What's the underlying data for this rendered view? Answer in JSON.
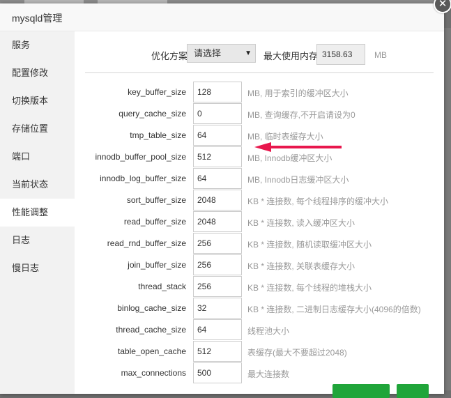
{
  "window": {
    "title": "mysqld管理",
    "close_glyph": "✕"
  },
  "sidebar": {
    "items": [
      {
        "label": "服务"
      },
      {
        "label": "配置修改"
      },
      {
        "label": "切换版本"
      },
      {
        "label": "存储位置"
      },
      {
        "label": "端口"
      },
      {
        "label": "当前状态"
      },
      {
        "label": "性能调整",
        "active": true
      },
      {
        "label": "日志"
      },
      {
        "label": "慢日志"
      }
    ]
  },
  "optimize": {
    "label": "优化方案",
    "selected": "请选择",
    "caret": "▼",
    "max_mem_label": "最大使用内存",
    "max_mem_value": "3158.63",
    "max_mem_unit": "MB"
  },
  "params": [
    {
      "name": "key_buffer_size",
      "value": "128",
      "desc": "MB, 用于索引的缓冲区大小"
    },
    {
      "name": "query_cache_size",
      "value": "0",
      "desc": "MB, 查询缓存,不开启请设为0"
    },
    {
      "name": "tmp_table_size",
      "value": "64",
      "desc": "MB, 临时表缓存大小"
    },
    {
      "name": "innodb_buffer_pool_size",
      "value": "512",
      "desc": "MB, Innodb缓冲区大小"
    },
    {
      "name": "innodb_log_buffer_size",
      "value": "64",
      "desc": "MB, Innodb日志缓冲区大小"
    },
    {
      "name": "sort_buffer_size",
      "value": "2048",
      "desc": "KB * 连接数, 每个线程排序的缓冲大小"
    },
    {
      "name": "read_buffer_size",
      "value": "2048",
      "desc": "KB * 连接数, 读入缓冲区大小"
    },
    {
      "name": "read_rnd_buffer_size",
      "value": "256",
      "desc": "KB * 连接数, 随机读取缓冲区大小"
    },
    {
      "name": "join_buffer_size",
      "value": "256",
      "desc": "KB * 连接数, 关联表缓存大小"
    },
    {
      "name": "thread_stack",
      "value": "256",
      "desc": "KB * 连接数, 每个线程的堆栈大小"
    },
    {
      "name": "binlog_cache_size",
      "value": "32",
      "desc": "KB * 连接数, 二进制日志缓存大小(4096的倍数)"
    },
    {
      "name": "thread_cache_size",
      "value": "64",
      "desc": "线程池大小"
    },
    {
      "name": "table_open_cache",
      "value": "512",
      "desc": "表缓存(最大不要超过2048)"
    },
    {
      "name": "max_connections",
      "value": "500",
      "desc": "最大连接数"
    }
  ],
  "colors": {
    "accent_green": "#20a53a",
    "annotation_arrow": "#e8174d"
  },
  "annotation": {
    "icon": "arrow-left-icon"
  }
}
